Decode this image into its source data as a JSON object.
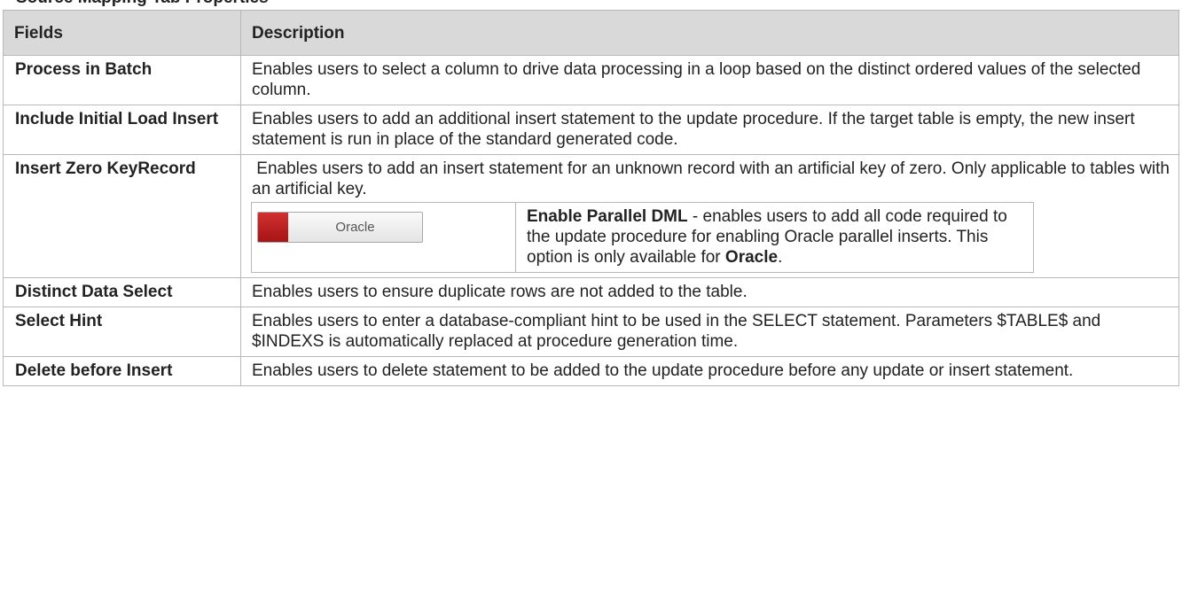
{
  "heading": "Source Mapping Tab Properties",
  "columns": [
    "Fields",
    "Description"
  ],
  "rows": [
    {
      "field": "Process in Batch",
      "description": "Enables users to select a column to drive data processing in a loop based on the distinct ordered values of the selected column."
    },
    {
      "field": "Include Initial Load Insert",
      "description": "Enables users to add an additional insert statement to the update procedure. If the target table is empty, the new insert statement is run in place of the standard generated code."
    },
    {
      "field": "Insert Zero KeyRecord",
      "description": " Enables users to add an insert statement for an unknown record with an artificial key of zero. Only applicable to tables with an artificial key.",
      "note": {
        "badge_label": "Oracle",
        "badge_color": "#b81c1c",
        "title": "Enable Parallel DML",
        "text": " - enables users to add all code required to the update procedure for enabling Oracle parallel inserts. This option is only available for ",
        "emph": "Oracle",
        "end": "."
      }
    },
    {
      "field": "Distinct Data Select",
      "description": "Enables users to ensure duplicate rows are not added to the table."
    },
    {
      "field": "Select Hint",
      "description": "Enables users to enter a database-compliant hint to be used in the SELECT statement. Parameters $TABLE$ and $INDEXS is automatically replaced at procedure generation time."
    },
    {
      "field": "Delete before Insert",
      "description": "Enables users to delete statement to be added to the update procedure before any update or insert statement."
    }
  ]
}
